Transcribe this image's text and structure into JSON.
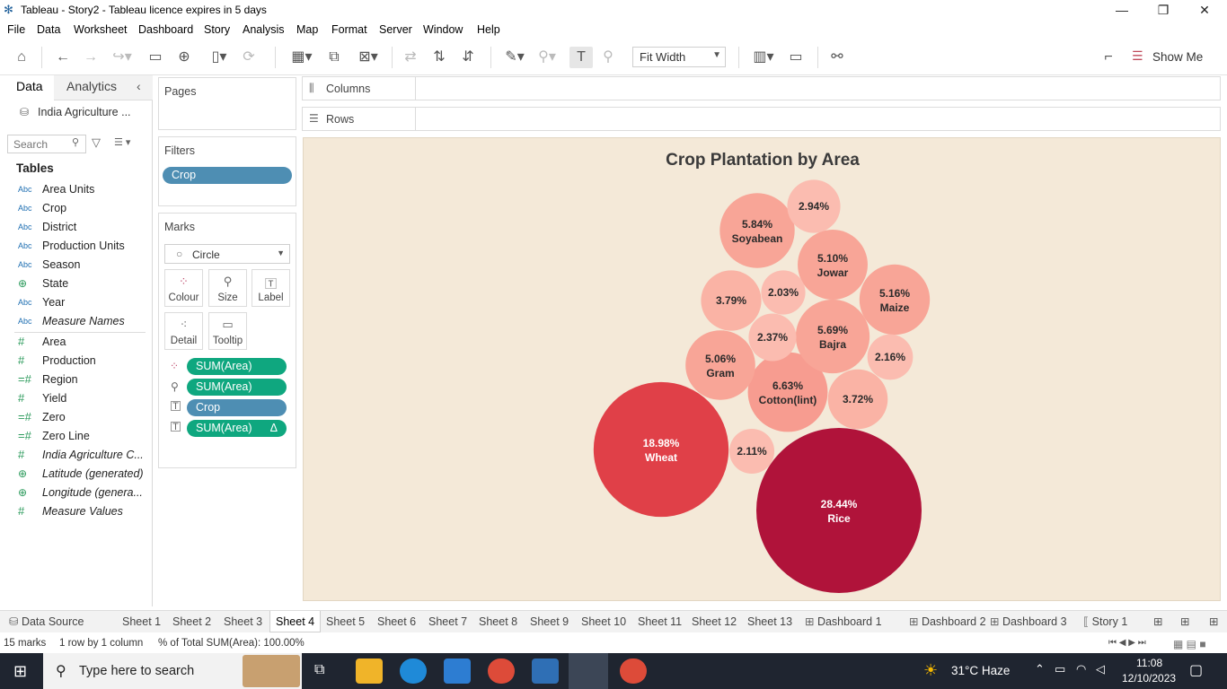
{
  "window": {
    "title": "Tableau - Story2 - Tableau licence expires in 5 days"
  },
  "menu": [
    "File",
    "Data",
    "Worksheet",
    "Dashboard",
    "Story",
    "Analysis",
    "Map",
    "Format",
    "Server",
    "Window",
    "Help"
  ],
  "toolbar": {
    "fit_label": "Fit Width",
    "show_me_label": "Show Me"
  },
  "left_pane": {
    "tab_data": "Data",
    "tab_analytics": "Analytics",
    "datasource": "India Agriculture ...",
    "search_placeholder": "Search",
    "tables_heading": "Tables",
    "dimensions": [
      {
        "type": "Abc",
        "name": "Area Units"
      },
      {
        "type": "Abc",
        "name": "Crop"
      },
      {
        "type": "Abc",
        "name": "District"
      },
      {
        "type": "Abc",
        "name": "Production Units"
      },
      {
        "type": "Abc",
        "name": "Season"
      },
      {
        "type": "globe",
        "name": "State"
      },
      {
        "type": "Abc",
        "name": "Year"
      },
      {
        "type": "Abc",
        "name": "Measure Names"
      }
    ],
    "measures": [
      {
        "type": "#",
        "name": "Area"
      },
      {
        "type": "#",
        "name": "Production"
      },
      {
        "type": "=#",
        "name": "Region"
      },
      {
        "type": "#",
        "name": "Yield"
      },
      {
        "type": "=#",
        "name": "Zero"
      },
      {
        "type": "=#",
        "name": "Zero Line"
      },
      {
        "type": "#",
        "name": "India Agriculture C..."
      },
      {
        "type": "globe",
        "name": "Latitude (generated)"
      },
      {
        "type": "globe",
        "name": "Longitude (genera..."
      },
      {
        "type": "#",
        "name": "Measure Values"
      }
    ]
  },
  "cards": {
    "pages": "Pages",
    "filters": "Filters",
    "filter_pill": "Crop",
    "marks": "Marks",
    "mark_type": "Circle",
    "mark_buttons": [
      "Colour",
      "Size",
      "Label",
      "Detail",
      "Tooltip"
    ],
    "mark_pills": [
      "SUM(Area)",
      "SUM(Area)",
      "Crop",
      "SUM(Area)"
    ],
    "delta": "Δ"
  },
  "shelves": {
    "columns": "Columns",
    "rows": "Rows"
  },
  "chart_data": {
    "type": "bubble",
    "title": "Crop Plantation by Area",
    "bubbles": [
      {
        "label": "Rice",
        "value": 28.44,
        "text": "28.44%",
        "color": "#b0133a",
        "textColor": "#ffffff"
      },
      {
        "label": "Wheat",
        "value": 18.98,
        "text": "18.98%",
        "color": "#e04048",
        "textColor": "#ffffff"
      },
      {
        "label": "Cotton(lint)",
        "value": 6.63,
        "text": "6.63%",
        "color": "#f79c90",
        "textColor": "#2a2a2a"
      },
      {
        "label": "Soyabean",
        "value": 5.84,
        "text": "5.84%",
        "color": "#f8a597",
        "textColor": "#2a2a2a"
      },
      {
        "label": "Bajra",
        "value": 5.69,
        "text": "5.69%",
        "color": "#f8a597",
        "textColor": "#2a2a2a"
      },
      {
        "label": "Maize",
        "value": 5.16,
        "text": "5.16%",
        "color": "#f8a597",
        "textColor": "#2a2a2a"
      },
      {
        "label": "Jowar",
        "value": 5.1,
        "text": "5.10%",
        "color": "#f8a597",
        "textColor": "#2a2a2a"
      },
      {
        "label": "Gram",
        "value": 5.06,
        "text": "5.06%",
        "color": "#f8a597",
        "textColor": "#2a2a2a"
      },
      {
        "label": "",
        "value": 3.79,
        "text": "3.79%",
        "color": "#fab3a5",
        "textColor": "#2a2a2a"
      },
      {
        "label": "",
        "value": 3.72,
        "text": "3.72%",
        "color": "#fab3a5",
        "textColor": "#2a2a2a"
      },
      {
        "label": "",
        "value": 2.94,
        "text": "2.94%",
        "color": "#fbbcb0",
        "textColor": "#2a2a2a"
      },
      {
        "label": "",
        "value": 2.37,
        "text": "2.37%",
        "color": "#fbbcb0",
        "textColor": "#2a2a2a"
      },
      {
        "label": "",
        "value": 2.16,
        "text": "2.16%",
        "color": "#fbbcb0",
        "textColor": "#2a2a2a"
      },
      {
        "label": "",
        "value": 2.11,
        "text": "2.11%",
        "color": "#fbbcb0",
        "textColor": "#2a2a2a"
      },
      {
        "label": "",
        "value": 2.03,
        "text": "2.03%",
        "color": "#fbbcb0",
        "textColor": "#2a2a2a"
      }
    ]
  },
  "sheet_tabs": [
    "Data Source",
    "Sheet 1",
    "Sheet 2",
    "Sheet 3",
    "Sheet 4",
    "Sheet 5",
    "Sheet 6",
    "Sheet 7",
    "Sheet 8",
    "Sheet 9",
    "Sheet 10",
    "Sheet 11",
    "Sheet 12",
    "Sheet 13",
    "Dashboard 1",
    "Dashboard 2",
    "Dashboard 3",
    "Story 1"
  ],
  "active_tab": "Sheet 4",
  "status": {
    "marks": "15 marks",
    "rows": "1 row  by  1 column",
    "sum": "% of Total SUM(Area): 100.00%"
  },
  "taskbar": {
    "search_placeholder": "Type here to search",
    "weather": "31°C  Haze",
    "time": "11:08",
    "date": "12/10/2023"
  }
}
